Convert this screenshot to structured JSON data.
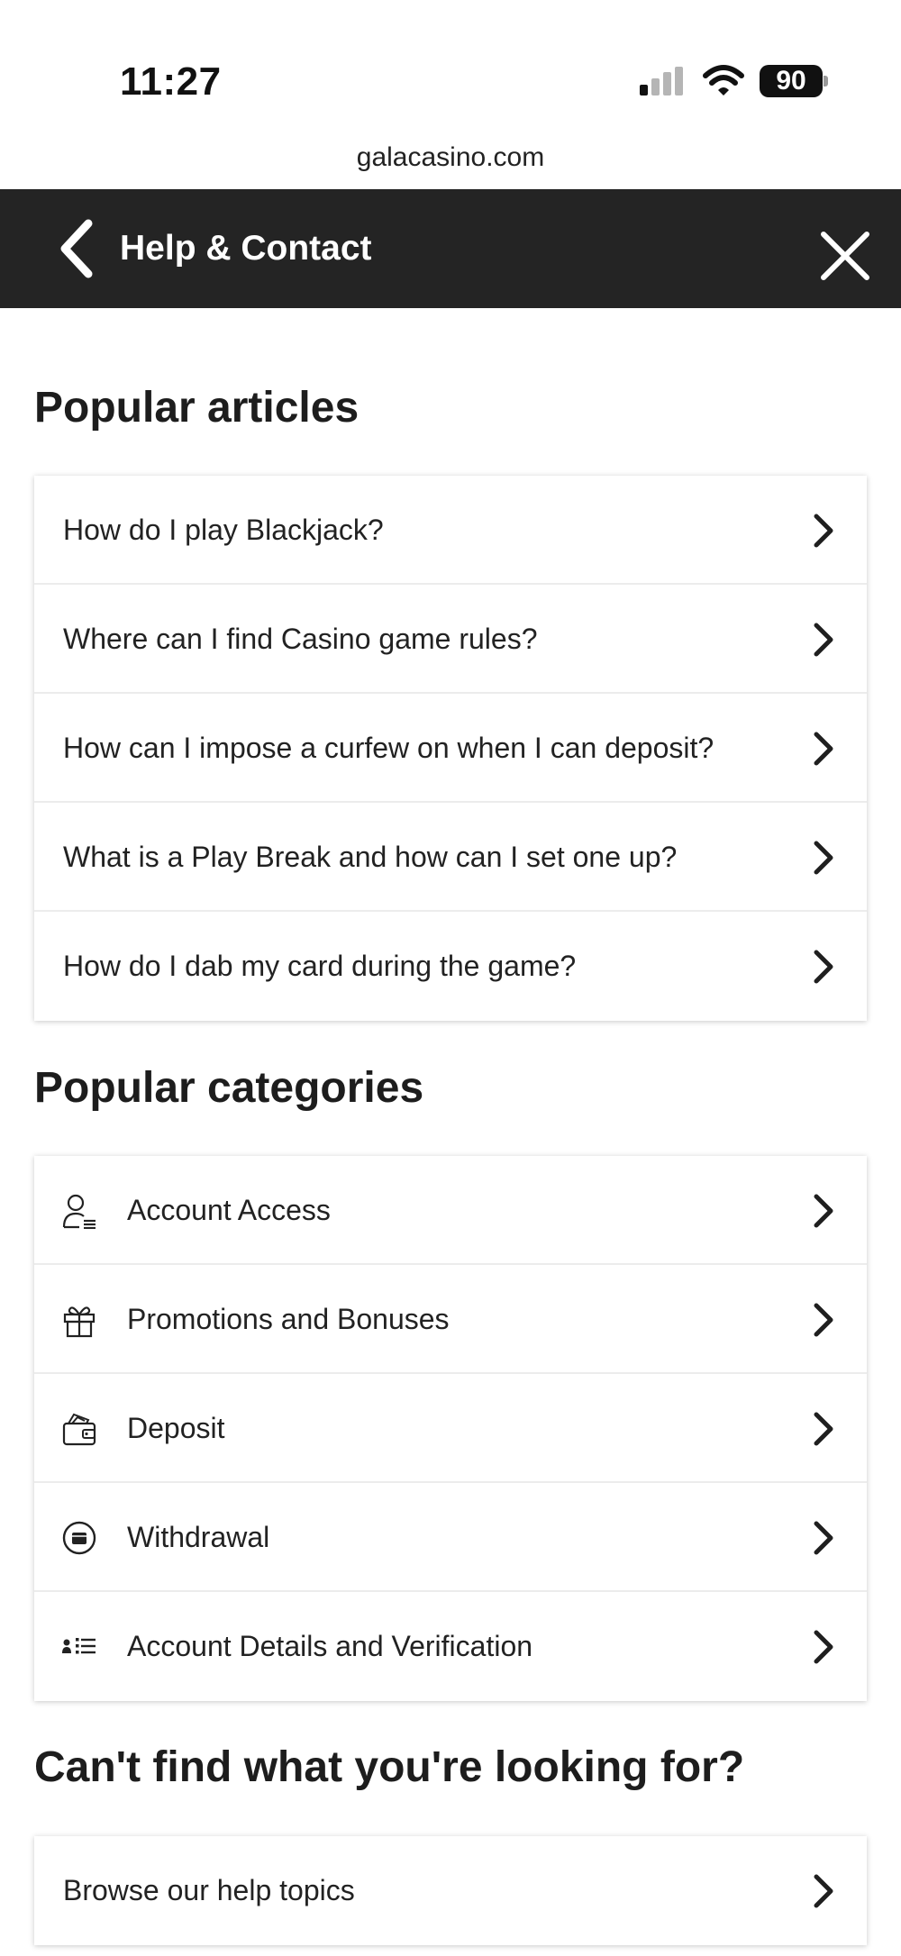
{
  "status_bar": {
    "time": "11:27",
    "battery": "90",
    "url": "galacasino.com"
  },
  "header": {
    "title": "Help & Contact",
    "back_icon": "chevron-left-icon",
    "close_icon": "close-icon"
  },
  "popular_articles": {
    "title": "Popular articles",
    "items": [
      {
        "label": "How do I play Blackjack?"
      },
      {
        "label": "Where can I find Casino game rules?"
      },
      {
        "label": "How can I impose a curfew on when I can deposit?"
      },
      {
        "label": "What is a Play Break and how can I set one up?"
      },
      {
        "label": "How do I dab my card during the game?"
      }
    ]
  },
  "popular_categories": {
    "title": "Popular categories",
    "items": [
      {
        "label": "Account Access",
        "icon": "user-list-icon"
      },
      {
        "label": "Promotions and Bonuses",
        "icon": "gift-icon"
      },
      {
        "label": "Deposit",
        "icon": "wallet-icon"
      },
      {
        "label": "Withdrawal",
        "icon": "withdrawal-circle-icon"
      },
      {
        "label": "Account Details and Verification",
        "icon": "id-list-icon"
      }
    ]
  },
  "cant_find": {
    "title": "Can't find what you're looking for?",
    "items": [
      {
        "label": "Browse our help topics"
      }
    ]
  },
  "colors": {
    "header_bg": "#242424",
    "text": "#1f1f1f",
    "page_bg": "#ffffff"
  }
}
